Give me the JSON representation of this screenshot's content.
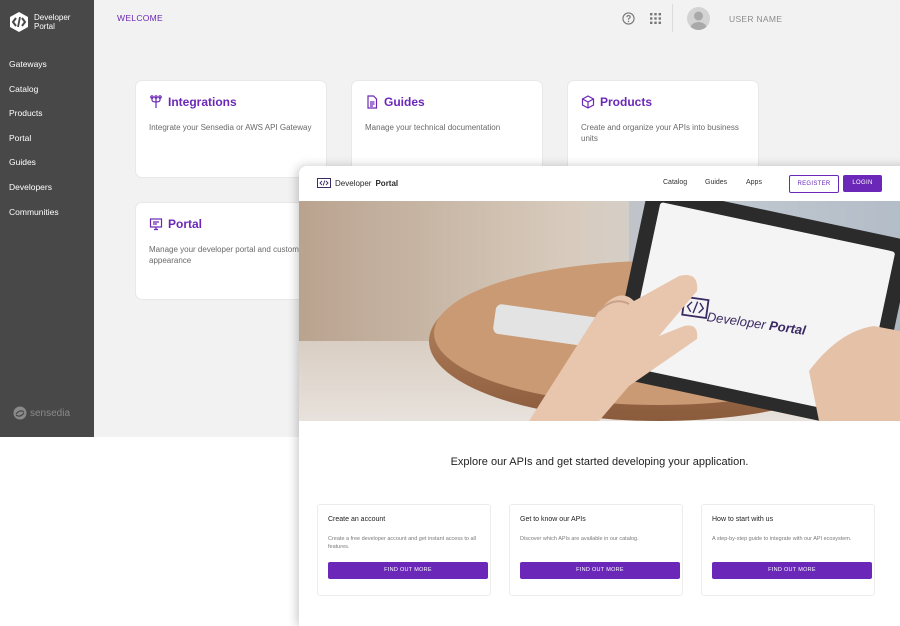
{
  "admin": {
    "logo_line1": "Developer",
    "logo_line2": "Portal",
    "nav": [
      "Gateways",
      "Catalog",
      "Products",
      "Portal",
      "Guides",
      "Developers",
      "Communities"
    ],
    "brand": "sensedia",
    "welcome": "WELCOME",
    "username": "USER NAME",
    "cards": [
      {
        "icon": "integrations-icon",
        "title": "Integrations",
        "desc": "Integrate your Sensedia or AWS API Gateway"
      },
      {
        "icon": "document-icon",
        "title": "Guides",
        "desc": "Manage your technical documentation"
      },
      {
        "icon": "cube-icon",
        "title": "Products",
        "desc": "Create and organize your APIs into business units"
      },
      {
        "icon": "monitor-icon",
        "title": "Portal",
        "desc": "Manage your developer portal and customize appearance"
      }
    ]
  },
  "portal": {
    "logo_regular": "Developer",
    "logo_bold": "Portal",
    "nav": [
      "Catalog",
      "Guides",
      "Apps"
    ],
    "register": "REGISTER",
    "login": "LOGIN",
    "hero_text_regular": "Developer",
    "hero_text_bold": "Portal",
    "tagline": "Explore our APIs and get started developing your application.",
    "cards": [
      {
        "title": "Create an account",
        "desc": "Create a free developer account and get instant access to all features.",
        "button": "FIND OUT MORE"
      },
      {
        "title": "Get to know our APIs",
        "desc": "Discover which APIs are available in our catalog.",
        "button": "FIND OUT MORE"
      },
      {
        "title": "How to start with us",
        "desc": "A step-by-step guide to integrate with our API ecosystem.",
        "button": "FIND OUT MORE"
      }
    ]
  },
  "colors": {
    "accent": "#6b28b8",
    "sidebar": "#484848",
    "background": "#f2f2f2"
  }
}
